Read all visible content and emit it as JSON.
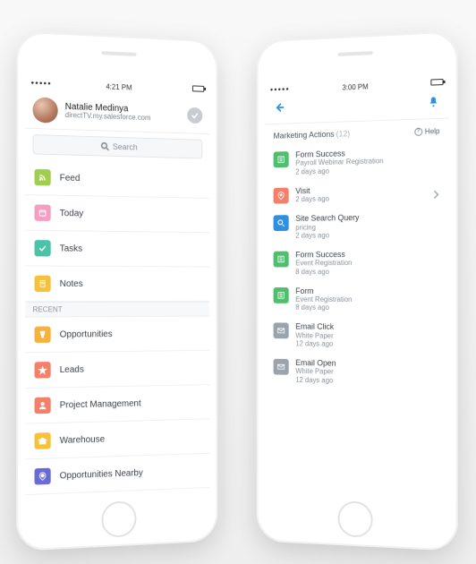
{
  "statusbar": {
    "left_time": "4:21 PM",
    "right_time": "3:00 PM"
  },
  "profile": {
    "name": "Natalie Medinya",
    "domain": "directTV.my.salesforce.com"
  },
  "search": {
    "placeholder": "Search"
  },
  "nav": {
    "main": [
      {
        "label": "Feed",
        "color": "#a0cf4f",
        "icon": "feed"
      },
      {
        "label": "Today",
        "color": "#f59ec1",
        "icon": "today"
      },
      {
        "label": "Tasks",
        "color": "#4bc3a6",
        "icon": "tasks"
      },
      {
        "label": "Notes",
        "color": "#f5c23a",
        "icon": "notes"
      }
    ],
    "recent_label": "RECENT",
    "recent": [
      {
        "label": "Opportunities",
        "color": "#f6b23c",
        "icon": "opp"
      },
      {
        "label": "Leads",
        "color": "#f5806a",
        "icon": "leads"
      },
      {
        "label": "Project Management",
        "color": "#f5806a",
        "icon": "proj"
      },
      {
        "label": "Warehouse",
        "color": "#f5c23a",
        "icon": "ware"
      },
      {
        "label": "Opportunities Nearby",
        "color": "#6b6bd6",
        "icon": "nearby"
      }
    ]
  },
  "marketing": {
    "header": "Marketing Actions",
    "count": "(12)",
    "help": "Help",
    "items": [
      {
        "kind": "form",
        "color": "#4fbf6e",
        "title": "Form Success",
        "sub": "Payroll Webinar Registration",
        "age": "2 days ago"
      },
      {
        "kind": "visit",
        "color": "#f5806a",
        "title": "Visit",
        "sub": "",
        "age": "2 days ago"
      },
      {
        "kind": "search",
        "color": "#2f8fe0",
        "title": "Site Search Query",
        "sub": "pricing",
        "age": "2 days ago"
      },
      {
        "kind": "form",
        "color": "#4fbf6e",
        "title": "Form Success",
        "sub": "Event Registration",
        "age": "8 days ago"
      },
      {
        "kind": "form",
        "color": "#4fbf6e",
        "title": "Form",
        "sub": "Event Registration",
        "age": "8 days ago"
      },
      {
        "kind": "email",
        "color": "#9aa4ad",
        "title": "Email Click",
        "sub": "White Paper",
        "age": "12 days ago"
      },
      {
        "kind": "email",
        "color": "#9aa4ad",
        "title": "Email Open",
        "sub": "White Paper",
        "age": "12 days ago"
      }
    ]
  }
}
